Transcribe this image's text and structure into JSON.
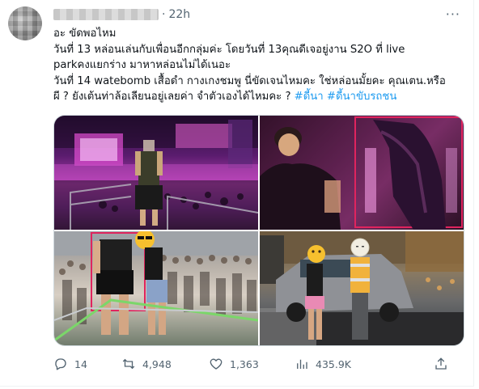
{
  "tweet": {
    "time": "22h",
    "more_label": "···",
    "lines": [
      "อะ ขัดพอไหม",
      "วันที่ 13 หล่อนเล่นกับเพื่อนอีกกลุ่มค่ะ โดยวันที่ 13คุณดีเจอยู่งาน S2O ที่ live",
      "parkคงแยกร่าง มาหาหล่อนไม่ได้เนอะ",
      "วันที่ 14 watebomb เสื้อดำ กางเกงชมพู นี่ขัดเจนไหมคะ ใช่หล่อนมั้ยคะ คุณเตน.หรือ",
      "ผี ? ยังเต้นท่าล้อเลียนอยู่เลยค่า จำตัวเองได้ไหมคะ ? "
    ],
    "hashtags": [
      "#ดี้นา",
      "#ดี้นาขับรถชน"
    ]
  },
  "actions": {
    "replies": "14",
    "retweets": "4,948",
    "likes": "1,363",
    "views": "435.9K"
  },
  "colors": {
    "link": "#1d9bf0",
    "muted": "#536471",
    "text": "#0f1419",
    "highlight_box": "#e0245e"
  }
}
